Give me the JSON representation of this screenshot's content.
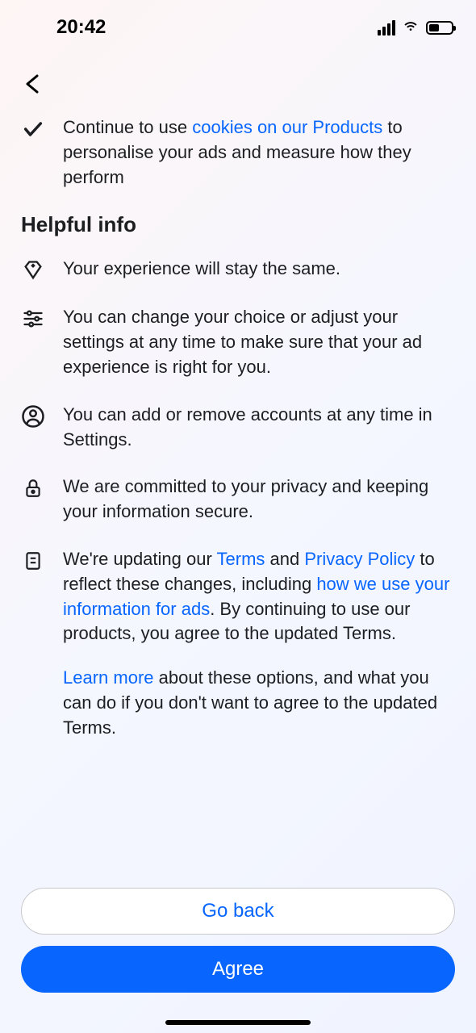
{
  "statusBar": {
    "time": "20:42"
  },
  "topItem": {
    "text_before_link": "Continue to use ",
    "link_text": "cookies on our Products",
    "text_after_link": " to personalise your ads and measure how they perform"
  },
  "section": {
    "heading": "Helpful info",
    "items": [
      {
        "text": "Your experience will stay the same."
      },
      {
        "text": "You can change your choice or adjust your settings at any time to make sure that your ad experience is right for you."
      },
      {
        "text": "You can add or remove accounts at any time in Settings."
      },
      {
        "text": "We are committed to your privacy and keeping your information secure."
      }
    ],
    "terms_item": {
      "part1": "We're updating our ",
      "link1": "Terms",
      "part2": " and ",
      "link2": "Privacy Policy",
      "part3": " to reflect these changes, including ",
      "link3": "how we use your information for ads",
      "part4": ". By continuing to use our products, you agree to the updated Terms."
    },
    "learn_more": {
      "link": "Learn more",
      "text": " about these options, and what you can do if you don't want to agree to the updated Terms."
    }
  },
  "buttons": {
    "secondary": "Go back",
    "primary": "Agree"
  }
}
